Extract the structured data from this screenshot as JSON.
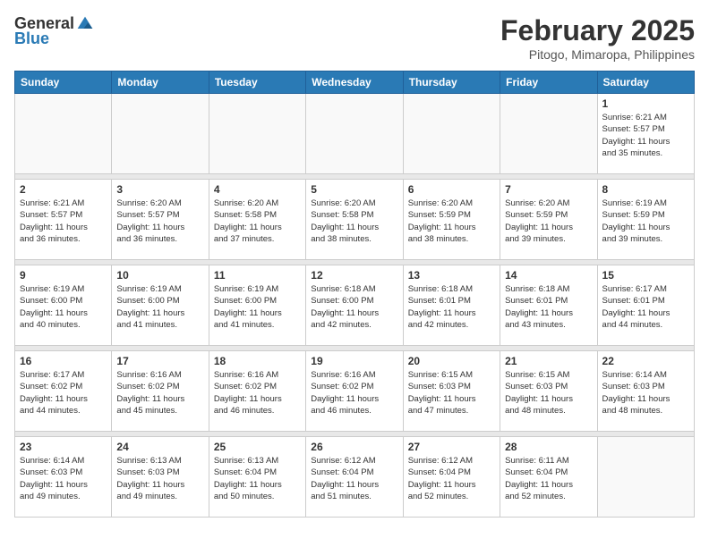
{
  "header": {
    "logo_general": "General",
    "logo_blue": "Blue",
    "month": "February 2025",
    "location": "Pitogo, Mimaropa, Philippines"
  },
  "weekdays": [
    "Sunday",
    "Monday",
    "Tuesday",
    "Wednesday",
    "Thursday",
    "Friday",
    "Saturday"
  ],
  "weeks": [
    [
      {
        "day": "",
        "info": ""
      },
      {
        "day": "",
        "info": ""
      },
      {
        "day": "",
        "info": ""
      },
      {
        "day": "",
        "info": ""
      },
      {
        "day": "",
        "info": ""
      },
      {
        "day": "",
        "info": ""
      },
      {
        "day": "1",
        "info": "Sunrise: 6:21 AM\nSunset: 5:57 PM\nDaylight: 11 hours\nand 35 minutes."
      }
    ],
    [
      {
        "day": "2",
        "info": "Sunrise: 6:21 AM\nSunset: 5:57 PM\nDaylight: 11 hours\nand 36 minutes."
      },
      {
        "day": "3",
        "info": "Sunrise: 6:20 AM\nSunset: 5:57 PM\nDaylight: 11 hours\nand 36 minutes."
      },
      {
        "day": "4",
        "info": "Sunrise: 6:20 AM\nSunset: 5:58 PM\nDaylight: 11 hours\nand 37 minutes."
      },
      {
        "day": "5",
        "info": "Sunrise: 6:20 AM\nSunset: 5:58 PM\nDaylight: 11 hours\nand 38 minutes."
      },
      {
        "day": "6",
        "info": "Sunrise: 6:20 AM\nSunset: 5:59 PM\nDaylight: 11 hours\nand 38 minutes."
      },
      {
        "day": "7",
        "info": "Sunrise: 6:20 AM\nSunset: 5:59 PM\nDaylight: 11 hours\nand 39 minutes."
      },
      {
        "day": "8",
        "info": "Sunrise: 6:19 AM\nSunset: 5:59 PM\nDaylight: 11 hours\nand 39 minutes."
      }
    ],
    [
      {
        "day": "9",
        "info": "Sunrise: 6:19 AM\nSunset: 6:00 PM\nDaylight: 11 hours\nand 40 minutes."
      },
      {
        "day": "10",
        "info": "Sunrise: 6:19 AM\nSunset: 6:00 PM\nDaylight: 11 hours\nand 41 minutes."
      },
      {
        "day": "11",
        "info": "Sunrise: 6:19 AM\nSunset: 6:00 PM\nDaylight: 11 hours\nand 41 minutes."
      },
      {
        "day": "12",
        "info": "Sunrise: 6:18 AM\nSunset: 6:00 PM\nDaylight: 11 hours\nand 42 minutes."
      },
      {
        "day": "13",
        "info": "Sunrise: 6:18 AM\nSunset: 6:01 PM\nDaylight: 11 hours\nand 42 minutes."
      },
      {
        "day": "14",
        "info": "Sunrise: 6:18 AM\nSunset: 6:01 PM\nDaylight: 11 hours\nand 43 minutes."
      },
      {
        "day": "15",
        "info": "Sunrise: 6:17 AM\nSunset: 6:01 PM\nDaylight: 11 hours\nand 44 minutes."
      }
    ],
    [
      {
        "day": "16",
        "info": "Sunrise: 6:17 AM\nSunset: 6:02 PM\nDaylight: 11 hours\nand 44 minutes."
      },
      {
        "day": "17",
        "info": "Sunrise: 6:16 AM\nSunset: 6:02 PM\nDaylight: 11 hours\nand 45 minutes."
      },
      {
        "day": "18",
        "info": "Sunrise: 6:16 AM\nSunset: 6:02 PM\nDaylight: 11 hours\nand 46 minutes."
      },
      {
        "day": "19",
        "info": "Sunrise: 6:16 AM\nSunset: 6:02 PM\nDaylight: 11 hours\nand 46 minutes."
      },
      {
        "day": "20",
        "info": "Sunrise: 6:15 AM\nSunset: 6:03 PM\nDaylight: 11 hours\nand 47 minutes."
      },
      {
        "day": "21",
        "info": "Sunrise: 6:15 AM\nSunset: 6:03 PM\nDaylight: 11 hours\nand 48 minutes."
      },
      {
        "day": "22",
        "info": "Sunrise: 6:14 AM\nSunset: 6:03 PM\nDaylight: 11 hours\nand 48 minutes."
      }
    ],
    [
      {
        "day": "23",
        "info": "Sunrise: 6:14 AM\nSunset: 6:03 PM\nDaylight: 11 hours\nand 49 minutes."
      },
      {
        "day": "24",
        "info": "Sunrise: 6:13 AM\nSunset: 6:03 PM\nDaylight: 11 hours\nand 49 minutes."
      },
      {
        "day": "25",
        "info": "Sunrise: 6:13 AM\nSunset: 6:04 PM\nDaylight: 11 hours\nand 50 minutes."
      },
      {
        "day": "26",
        "info": "Sunrise: 6:12 AM\nSunset: 6:04 PM\nDaylight: 11 hours\nand 51 minutes."
      },
      {
        "day": "27",
        "info": "Sunrise: 6:12 AM\nSunset: 6:04 PM\nDaylight: 11 hours\nand 52 minutes."
      },
      {
        "day": "28",
        "info": "Sunrise: 6:11 AM\nSunset: 6:04 PM\nDaylight: 11 hours\nand 52 minutes."
      },
      {
        "day": "",
        "info": ""
      }
    ]
  ]
}
